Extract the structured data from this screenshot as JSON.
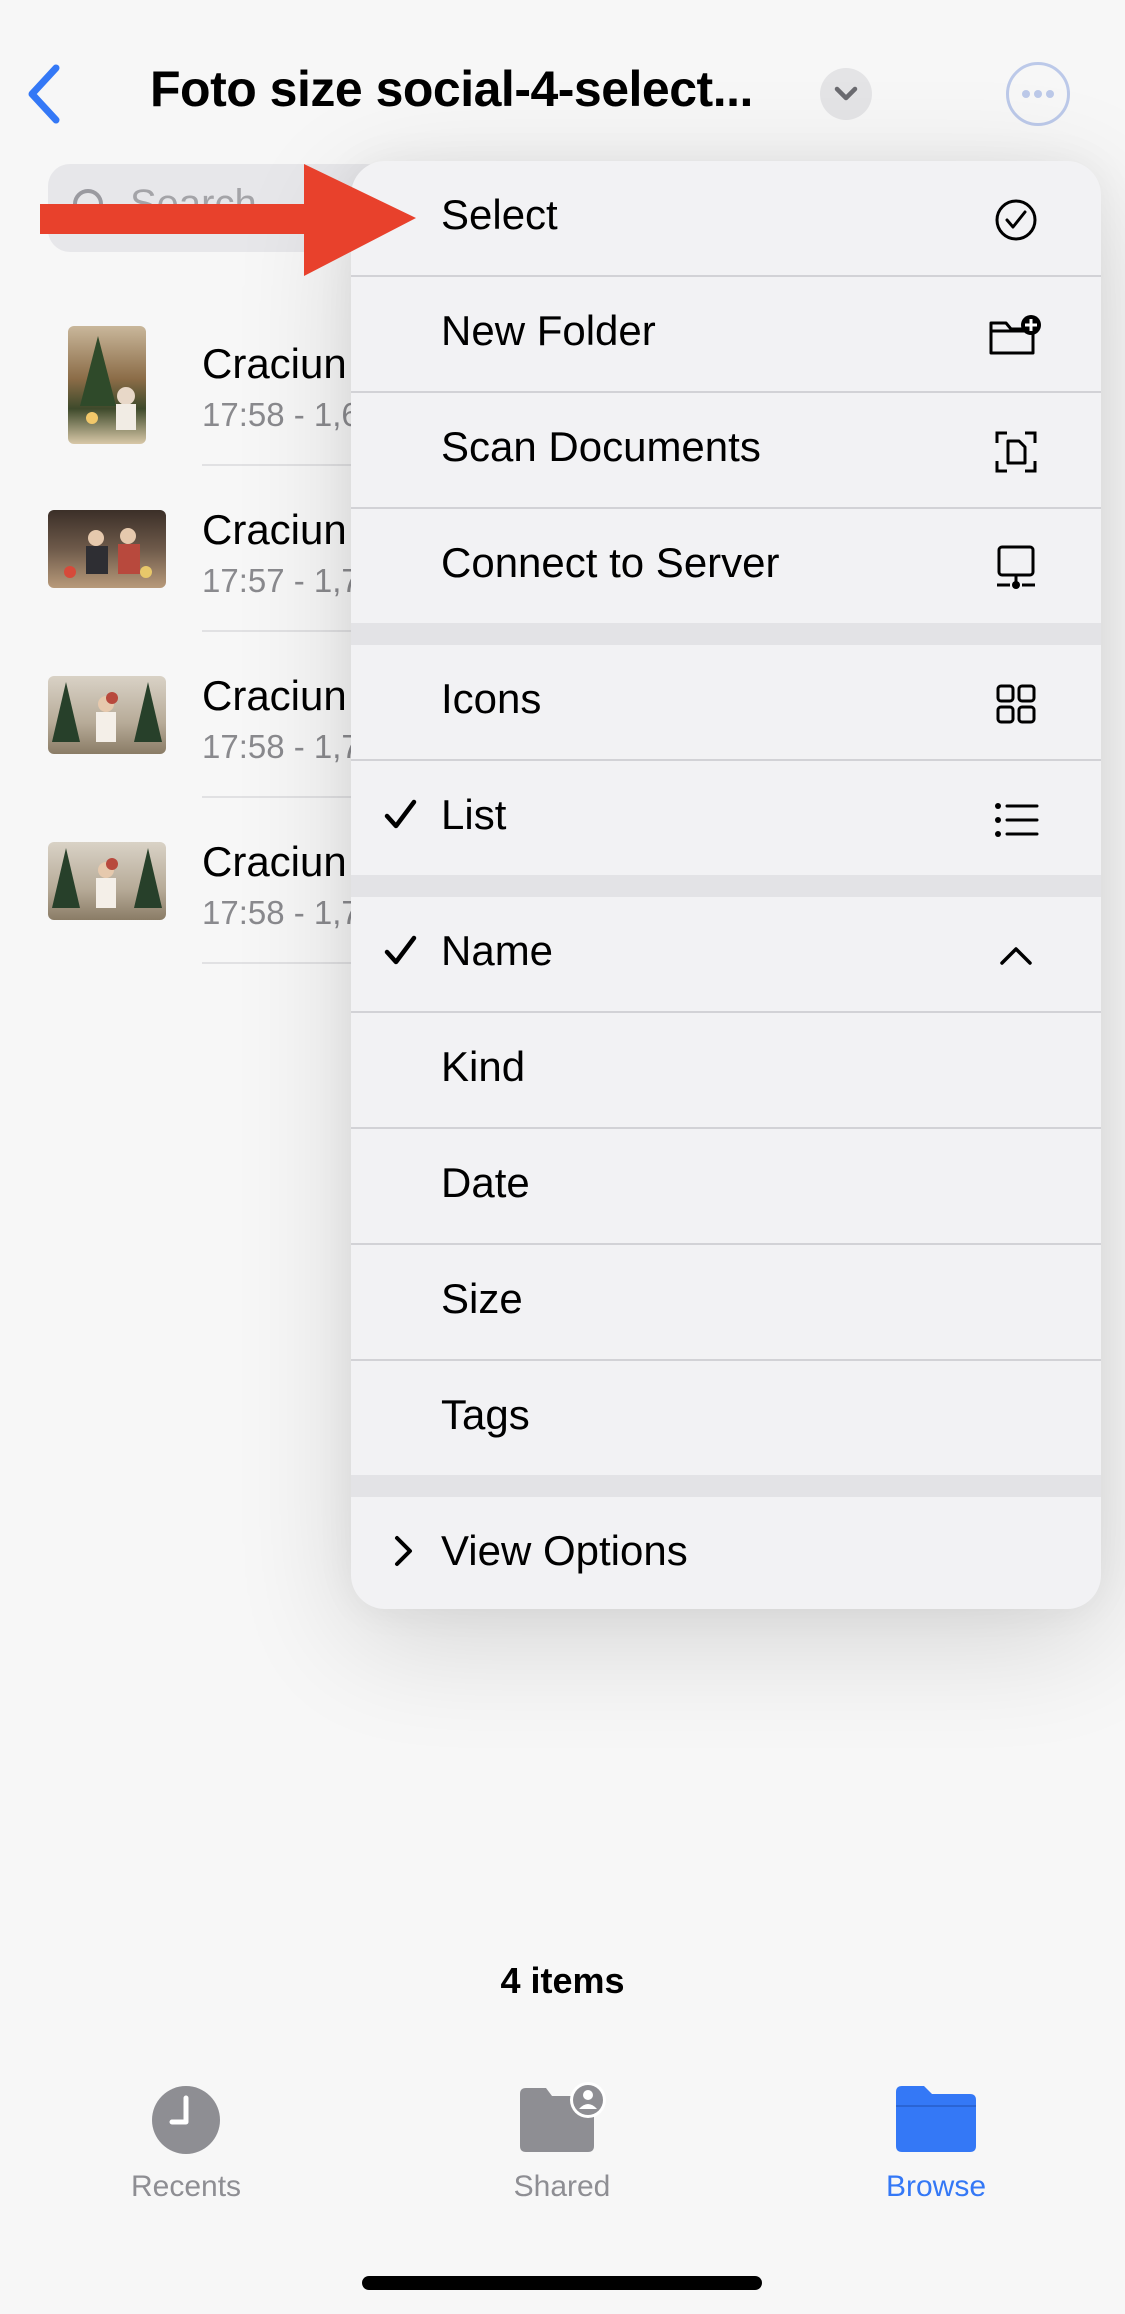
{
  "nav": {
    "title": "Foto size social-4-select..."
  },
  "search": {
    "placeholder": "Search"
  },
  "files": [
    {
      "name": "Craciun",
      "meta": "17:58 - 1,6"
    },
    {
      "name": "Craciun",
      "meta": "17:57 - 1,7"
    },
    {
      "name": "Craciun",
      "meta": "17:58 - 1,7"
    },
    {
      "name": "Craciun",
      "meta": "17:58 - 1,7"
    }
  ],
  "menu": {
    "items": [
      {
        "label": "Select",
        "icon": "select-circle-check-icon",
        "checked": false
      },
      {
        "label": "New Folder",
        "icon": "folder-plus-icon",
        "checked": false
      },
      {
        "label": "Scan Documents",
        "icon": "scan-document-icon",
        "checked": false
      },
      {
        "label": "Connect to Server",
        "icon": "server-display-icon",
        "checked": false
      },
      {
        "label": "Icons",
        "icon": "grid-icon",
        "checked": false
      },
      {
        "label": "List",
        "icon": "list-icon",
        "checked": true
      },
      {
        "label": "Name",
        "icon": "chevron-up-icon",
        "checked": true
      },
      {
        "label": "Kind",
        "checked": false
      },
      {
        "label": "Date",
        "checked": false
      },
      {
        "label": "Size",
        "checked": false
      },
      {
        "label": "Tags",
        "checked": false
      },
      {
        "label": "View Options",
        "icon": "chevron-right-icon",
        "checked": false
      }
    ]
  },
  "footer": {
    "item_count": "4 items"
  },
  "tabs": [
    {
      "label": "Recents",
      "icon": "clock-icon",
      "active": false
    },
    {
      "label": "Shared",
      "icon": "shared-folder-icon",
      "active": false
    },
    {
      "label": "Browse",
      "icon": "folder-icon",
      "active": true
    }
  ],
  "colors": {
    "accent": "#3478f6",
    "annotation_arrow": "#e8412c",
    "inactive_tab": "#8e8e93"
  }
}
